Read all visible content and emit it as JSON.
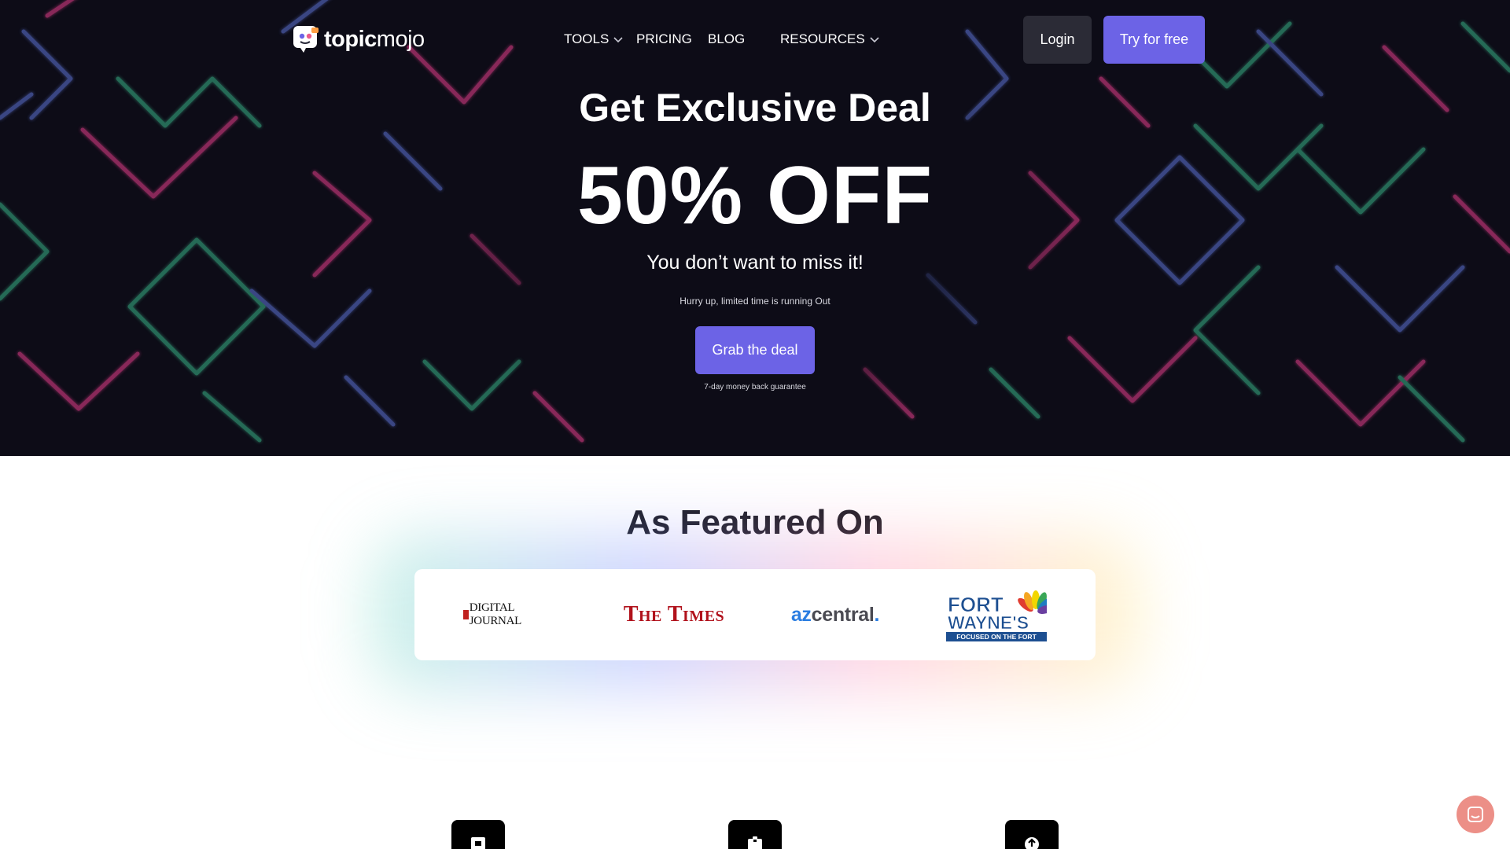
{
  "brand": {
    "name_bold": "topic",
    "name_light": "mojo",
    "colors": {
      "primary": "#6c63e6",
      "hero_bg": "#0d0c17",
      "login_bg": "#2b2b36",
      "chat": "#ec8f87"
    }
  },
  "nav": {
    "items": [
      {
        "label": "TOOLS",
        "has_dropdown": true
      },
      {
        "label": "PRICING",
        "has_dropdown": false
      },
      {
        "label": "BLOG",
        "has_dropdown": false
      },
      {
        "label": "RESOURCES",
        "has_dropdown": true
      }
    ],
    "login": "Login",
    "try_free": "Try for free"
  },
  "hero": {
    "headline": "Get Exclusive Deal",
    "offer": "50% OFF",
    "subhead": "You don’t want to miss it!",
    "urgency": "Hurry up, limited time is running Out",
    "cta": "Grab the deal",
    "guarantee": "7-day money back guarantee"
  },
  "featured": {
    "title": "As Featured On",
    "logos": [
      {
        "name": "digital-journal",
        "text": "DIGITAL JOURNAL"
      },
      {
        "name": "the-times",
        "text": "The Times"
      },
      {
        "name": "azcentral",
        "text_a": "az",
        "text_b": "central",
        "text_c": "."
      },
      {
        "name": "fort-waynes",
        "line1": "FORT",
        "line2": "WAYNE'S",
        "tagline": "FOCUSED ON THE FORT"
      }
    ]
  },
  "features": {
    "icons": [
      "calendar-icon",
      "clipboard-icon",
      "upload-icon"
    ]
  },
  "chat": {
    "icon": "chat-icon"
  }
}
